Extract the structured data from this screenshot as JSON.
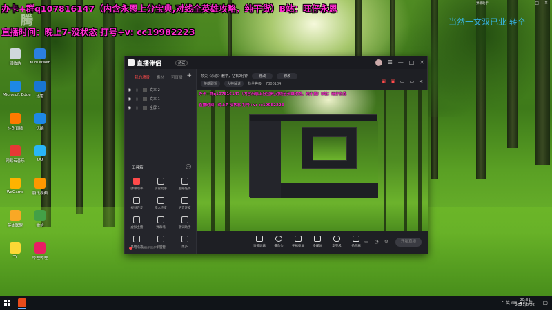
{
  "overlay": {
    "line1": "办卡+群q107816147（内含永恩上分宝典,对线全英雄攻略，纯干货）B站：旺仔永恩",
    "line2": "直播时间：晚上7-没状态  打号+v: cc19982223",
    "watermark_right": "当然一文双已业 转全",
    "watermark_left": "腾"
  },
  "sys_top": {
    "title": "弹幕助手"
  },
  "desktop_icons": [
    {
      "label": "回收站",
      "color": "#cfd8dc"
    },
    {
      "label": "XunLeiWeb",
      "color": "#2b7fe0"
    },
    {
      "label": "Microsoft Edge",
      "color": "#1e88e5"
    },
    {
      "label": "迅雷",
      "color": "#1976d2"
    },
    {
      "label": "斗鱼直播",
      "color": "#ff7a00"
    },
    {
      "label": "优酷",
      "color": "#1e88e5"
    },
    {
      "label": "网易云音乐",
      "color": "#e53935"
    },
    {
      "label": "QQ",
      "color": "#29b6f6"
    },
    {
      "label": "WeGame",
      "color": "#ffb300"
    },
    {
      "label": "腾讯视频",
      "color": "#ff9800"
    },
    {
      "label": "英雄联盟",
      "color": "#f9a825"
    },
    {
      "label": "微信",
      "color": "#43a047"
    },
    {
      "label": "YY",
      "color": "#fdd835"
    },
    {
      "label": "哔哩哔哩",
      "color": "#e91e63"
    }
  ],
  "app": {
    "logo_text": "直播伴侣",
    "version_badge": "测试",
    "tabs": [
      "我的场景",
      "素材",
      "可直播"
    ],
    "tab_add": "+",
    "scenes": [
      "文本 2",
      "文本 1",
      "全屏 1"
    ],
    "toolbox_title": "工具箱",
    "toolbox_more": "···",
    "tools": [
      "弹幕助手",
      "房管助手",
      "主播任务",
      "视频连麦",
      "多人连麦",
      "语音连麦",
      "虚拟主播",
      "弹幕墙",
      "歌词助手",
      "直播连麦",
      "小时榜",
      "更多"
    ],
    "left_footer": "斗鱼直播伴侣使用教程",
    "info_row1": [
      "顶尖《永恩》教学，钻石2分钟",
      "修改",
      "修改"
    ],
    "info_row2": [
      "英雄联盟",
      "大神解说",
      "粉丝等级",
      "7300104"
    ],
    "preview_line1": "办卡+群q107816147（内含永恩上分宝典,对线全英雄攻略，纯干货）B站：旺仔永恩",
    "preview_line2": "直播时间：晚上7-没状态  打号+v: cc19982223",
    "bottom_buttons": [
      "直播屏幕",
      "摄像头",
      "手机投屏",
      "多媒体",
      "麦克风",
      "扬声器"
    ],
    "live_button": "开始直播"
  },
  "taskbar": {
    "time": "20:31",
    "date": "2021/8/22",
    "tray_text": "^ 英 ⌨ ◀ 0) 英"
  },
  "colors": {
    "overlay_text": "#ff2ad0",
    "accent_red": "#ff4a4a",
    "app_bg": "#1e1f24"
  }
}
